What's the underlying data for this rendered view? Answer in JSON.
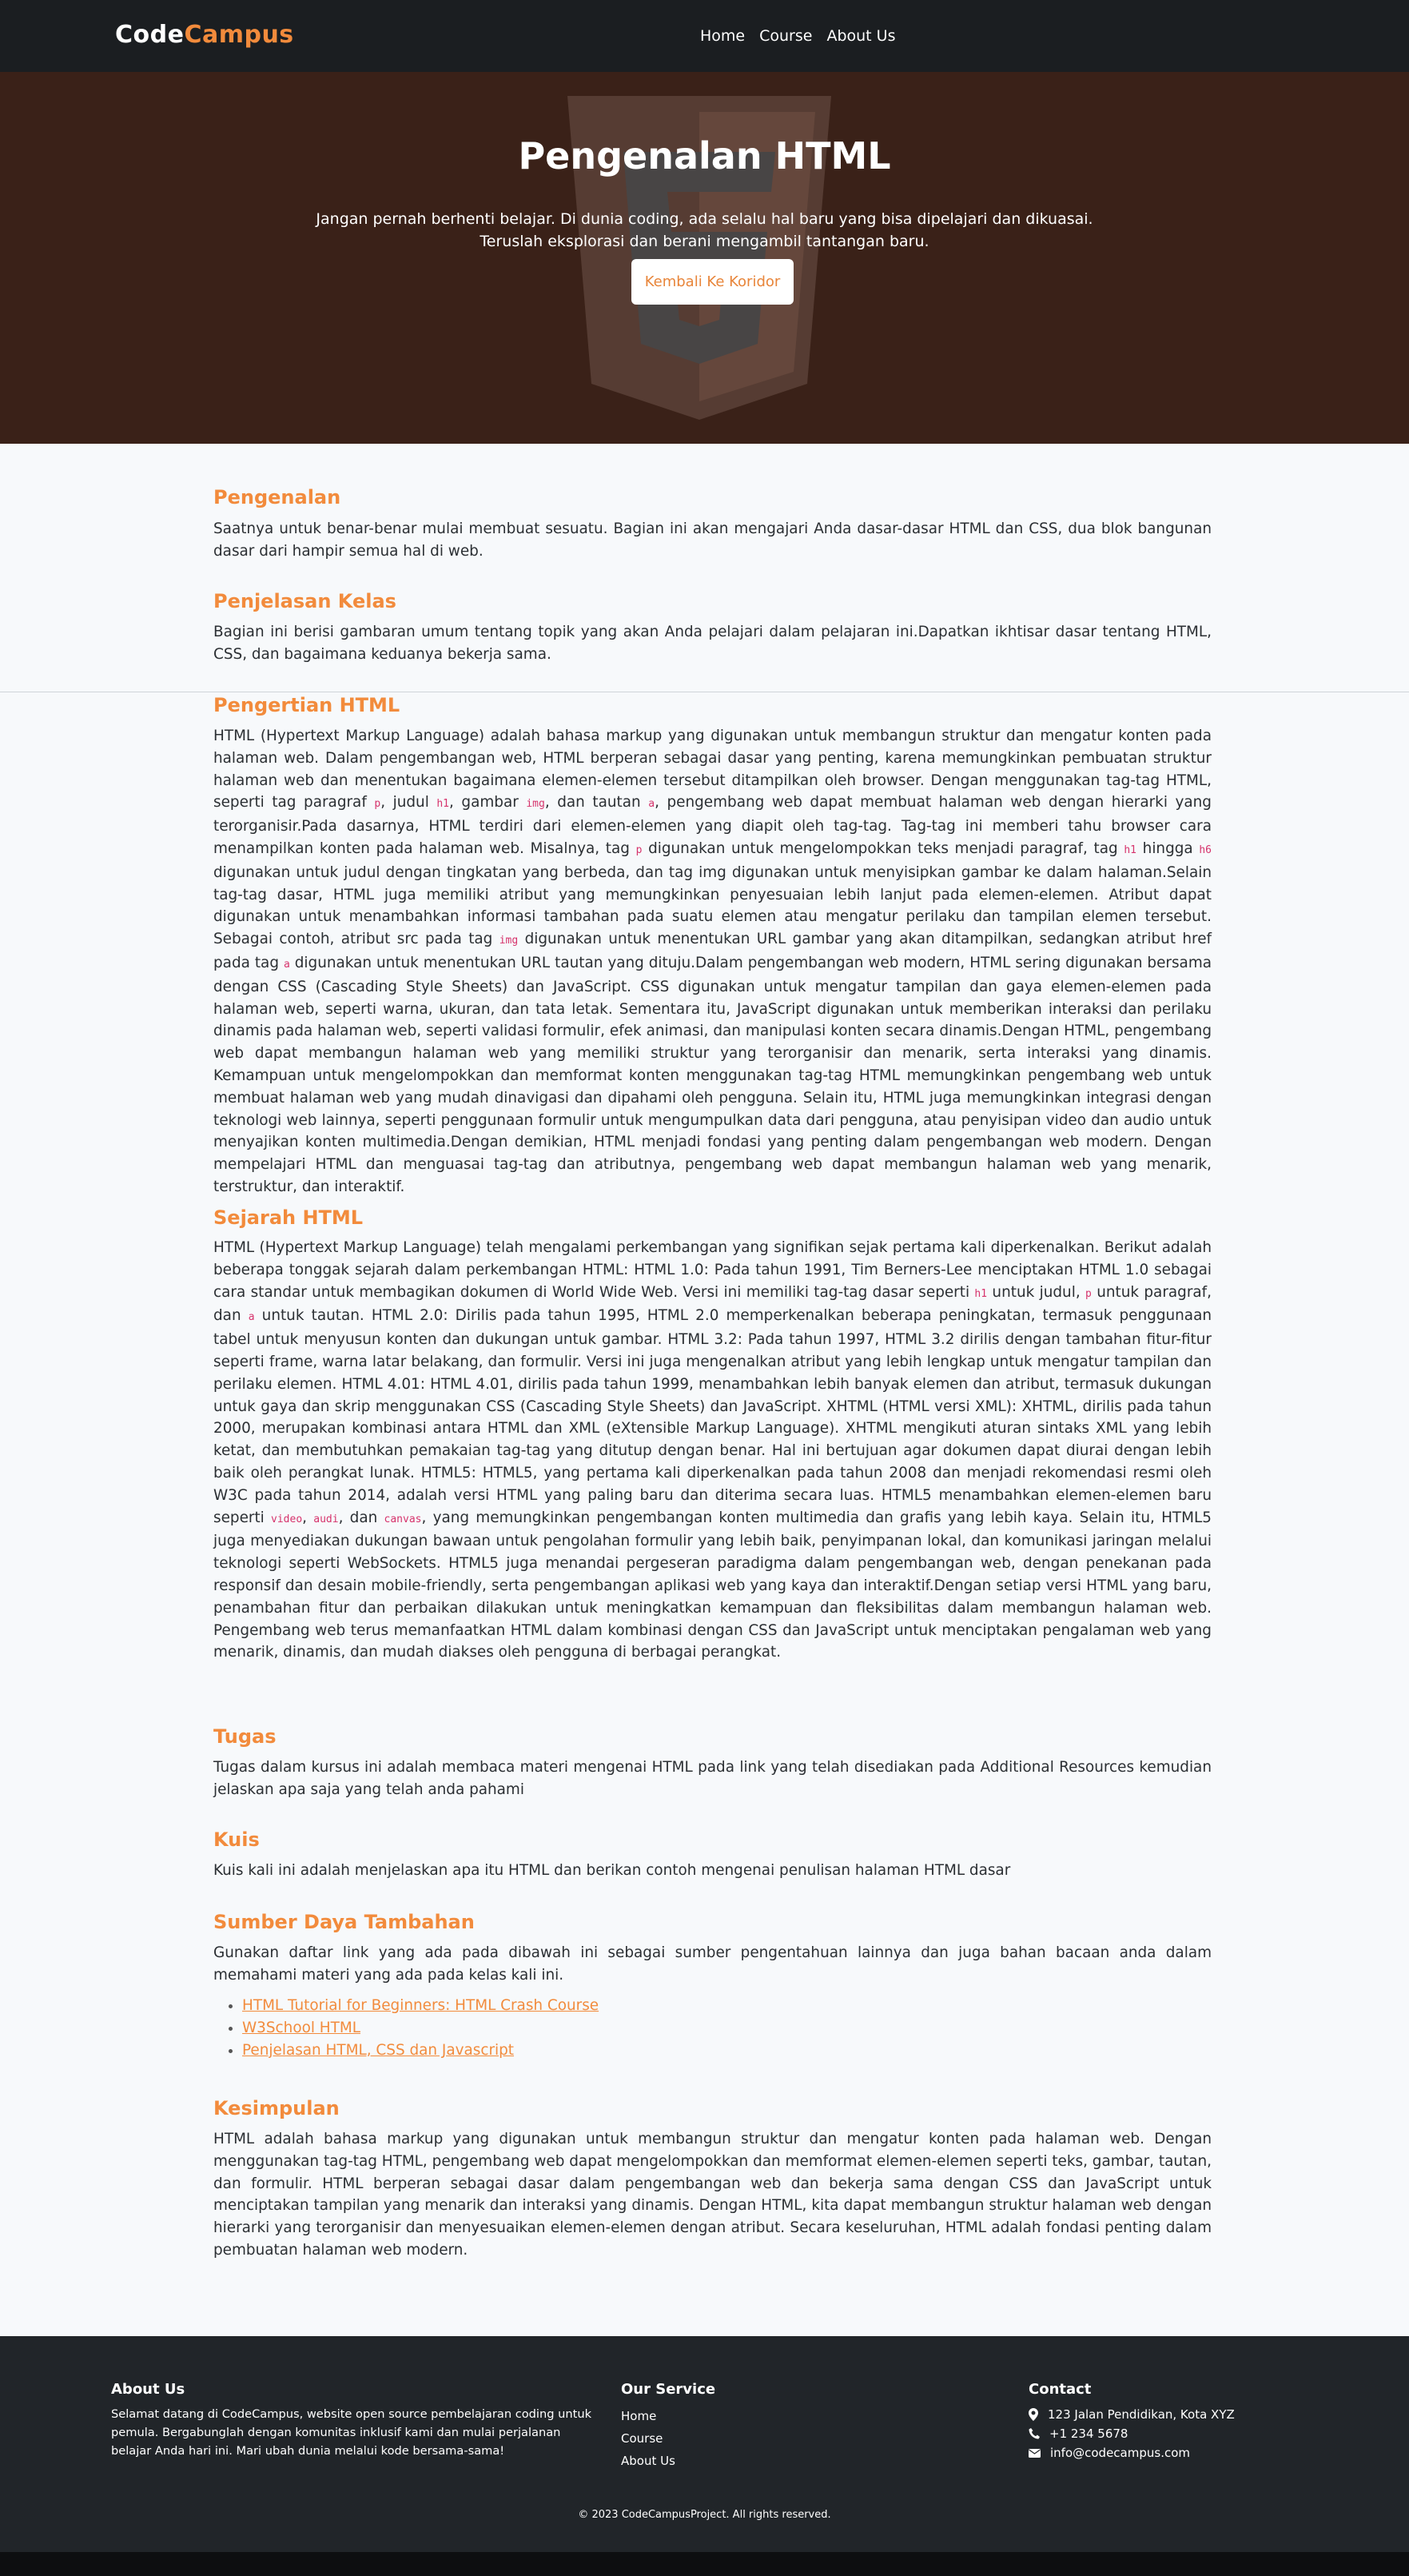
{
  "brand": {
    "name_part1": "Code",
    "name_part2": "Campus"
  },
  "nav": {
    "items": [
      "Home",
      "Course",
      "About Us"
    ]
  },
  "hero": {
    "title": "Pengenalan HTML",
    "subtitle_line1": "Jangan pernah berhenti belajar. Di dunia coding, ada selalu hal baru yang bisa dipelajari dan dikuasai.",
    "subtitle_line2": "Teruslah eksplorasi dan berani mengambil tantangan baru.",
    "button": "Kembali Ke Koridor",
    "background_icon": "html5-shield-icon"
  },
  "sections": {
    "pengenalan": {
      "title": "Pengenalan",
      "text": "Saatnya untuk benar-benar mulai membuat sesuatu. Bagian ini akan mengajari Anda dasar-dasar HTML dan CSS, dua blok bangunan dasar dari hampir semua hal di web."
    },
    "penjelasan": {
      "title": "Penjelasan Kelas",
      "text": "Bagian ini berisi gambaran umum tentang topik yang akan Anda pelajari dalam pelajaran ini.Dapatkan ikhtisar dasar tentang HTML, CSS, dan bagaimana keduanya bekerja sama."
    },
    "pengertian": {
      "title": "Pengertian HTML"
    },
    "sejarah": {
      "title": "Sejarah HTML"
    },
    "tugas": {
      "title": "Tugas",
      "text": "Tugas dalam kursus ini adalah membaca materi mengenai HTML pada link yang telah disediakan pada Additional Resources kemudian jelaskan apa saja yang telah anda pahami"
    },
    "kuis": {
      "title": "Kuis",
      "text": "Kuis kali ini adalah menjelaskan apa itu HTML dan berikan contoh mengenai penulisan halaman HTML dasar"
    },
    "sumber": {
      "title": "Sumber Daya Tambahan",
      "text": "Gunakan daftar link yang ada pada dibawah ini sebagai sumber pengentahuan lainnya dan juga bahan bacaan anda dalam memahami materi yang ada pada kelas kali ini.",
      "links": [
        "HTML Tutorial for Beginners: HTML Crash Course",
        "W3School HTML",
        "Penjelasan HTML, CSS dan Javascript"
      ]
    },
    "kesimpulan": {
      "title": "Kesimpulan",
      "text": "HTML adalah bahasa markup yang digunakan untuk membangun struktur dan mengatur konten pada halaman web. Dengan menggunakan tag-tag HTML, pengembang web dapat mengelompokkan dan memformat elemen-elemen seperti teks, gambar, tautan, dan formulir. HTML berperan sebagai dasar dalam pengembangan web dan bekerja sama dengan CSS dan JavaScript untuk menciptakan tampilan yang menarik dan interaksi yang dinamis. Dengan HTML, kita dapat membangun struktur halaman web dengan hierarki yang terorganisir dan menyesuaikan elemen-elemen dengan atribut. Secara keseluruhan, HTML adalah fondasi penting dalam pembuatan halaman web modern."
    }
  },
  "pengertian_text": {
    "s1": "HTML (Hypertext Markup Language) adalah bahasa markup yang digunakan untuk membangun struktur dan mengatur konten pada halaman web. Dalam pengembangan web, HTML berperan sebagai dasar yang penting, karena memungkinkan pembuatan struktur halaman web dan menentukan bagaimana elemen-elemen tersebut ditampilkan oleh browser. Dengan menggunakan tag-tag HTML, seperti tag paragraf ",
    "c1": "p",
    "s2": ", judul ",
    "c2": "h1",
    "s3": ", gambar ",
    "c3": "img",
    "s4": ", dan tautan ",
    "c4": "a",
    "s5": ", pengembang web dapat membuat halaman web dengan hierarki yang terorganisir.Pada dasarnya, HTML terdiri dari elemen-elemen yang diapit oleh tag-tag. Tag-tag ini memberi tahu browser cara menampilkan konten pada halaman web. Misalnya, tag ",
    "c5": "p",
    "s6": " digunakan untuk mengelompokkan teks menjadi paragraf, tag ",
    "c6": "h1",
    "s7": " hingga ",
    "c7": "h6",
    "s8": " digunakan untuk judul dengan tingkatan yang berbeda, dan tag img digunakan untuk menyisipkan gambar ke dalam halaman.Selain tag-tag dasar, HTML juga memiliki atribut yang memungkinkan penyesuaian lebih lanjut pada elemen-elemen. Atribut dapat digunakan untuk menambahkan informasi tambahan pada suatu elemen atau mengatur perilaku dan tampilan elemen tersebut. Sebagai contoh, atribut src pada tag ",
    "c8": "img",
    "s9": " digunakan untuk menentukan URL gambar yang akan ditampilkan, sedangkan atribut href pada tag ",
    "c9": "a",
    "s10": " digunakan untuk menentukan URL tautan yang dituju.Dalam pengembangan web modern, HTML sering digunakan bersama dengan CSS (Cascading Style Sheets) dan JavaScript. CSS digunakan untuk mengatur tampilan dan gaya elemen-elemen pada halaman web, seperti warna, ukuran, dan tata letak. Sementara itu, JavaScript digunakan untuk memberikan interaksi dan perilaku dinamis pada halaman web, seperti validasi formulir, efek animasi, dan manipulasi konten secara dinamis.Dengan HTML, pengembang web dapat membangun halaman web yang memiliki struktur yang terorganisir dan menarik, serta interaksi yang dinamis. Kemampuan untuk mengelompokkan dan memformat konten menggunakan tag-tag HTML memungkinkan pengembang web untuk membuat halaman web yang mudah dinavigasi dan dipahami oleh pengguna. Selain itu, HTML juga memungkinkan integrasi dengan teknologi web lainnya, seperti penggunaan formulir untuk mengumpulkan data dari pengguna, atau penyisipan video dan audio untuk menyajikan konten multimedia.Dengan demikian, HTML menjadi fondasi yang penting dalam pengembangan web modern. Dengan mempelajari HTML dan menguasai tag-tag dan atributnya, pengembang web dapat membangun halaman web yang menarik, terstruktur, dan interaktif."
  },
  "sejarah_text": {
    "s1": "HTML (Hypertext Markup Language) telah mengalami perkembangan yang signifikan sejak pertama kali diperkenalkan. Berikut adalah beberapa tonggak sejarah dalam perkembangan HTML: HTML 1.0: Pada tahun 1991, Tim Berners-Lee menciptakan HTML 1.0 sebagai cara standar untuk membagikan dokumen di World Wide Web. Versi ini memiliki tag-tag dasar seperti ",
    "c1": "h1",
    "s2": " untuk judul, ",
    "c2": "p",
    "s3": " untuk paragraf, dan ",
    "c3": "a",
    "s4": " untuk tautan. HTML 2.0: Dirilis pada tahun 1995, HTML 2.0 memperkenalkan beberapa peningkatan, termasuk penggunaan tabel untuk menyusun konten dan dukungan untuk gambar. HTML 3.2: Pada tahun 1997, HTML 3.2 dirilis dengan tambahan fitur-fitur seperti frame, warna latar belakang, dan formulir. Versi ini juga mengenalkan atribut yang lebih lengkap untuk mengatur tampilan dan perilaku elemen. HTML 4.01: HTML 4.01, dirilis pada tahun 1999, menambahkan lebih banyak elemen dan atribut, termasuk dukungan untuk gaya dan skrip menggunakan CSS (Cascading Style Sheets) dan JavaScript. XHTML (HTML versi XML): XHTML, dirilis pada tahun 2000, merupakan kombinasi antara HTML dan XML (eXtensible Markup Language). XHTML mengikuti aturan sintaks XML yang lebih ketat, dan membutuhkan pemakaian tag-tag yang ditutup dengan benar. Hal ini bertujuan agar dokumen dapat diurai dengan lebih baik oleh perangkat lunak. HTML5: HTML5, yang pertama kali diperkenalkan pada tahun 2008 dan menjadi rekomendasi resmi oleh W3C pada tahun 2014, adalah versi HTML yang paling baru dan diterima secara luas. HTML5 menambahkan elemen-elemen baru seperti ",
    "c4": "video",
    "s5": ", ",
    "c5": "audi",
    "s6": ", dan ",
    "c6": "canvas",
    "s7": ", yang memungkinkan pengembangan konten multimedia dan grafis yang lebih kaya. Selain itu, HTML5 juga menyediakan dukungan bawaan untuk pengolahan formulir yang lebih baik, penyimpanan lokal, dan komunikasi jaringan melalui teknologi seperti WebSockets. HTML5 juga menandai pergeseran paradigma dalam pengembangan web, dengan penekanan pada responsif dan desain mobile-friendly, serta pengembangan aplikasi web yang kaya dan interaktif.Dengan setiap versi HTML yang baru, penambahan fitur dan perbaikan dilakukan untuk meningkatkan kemampuan dan fleksibilitas dalam membangun halaman web. Pengembang web terus memanfaatkan HTML dalam kombinasi dengan CSS dan JavaScript untuk menciptakan pengalaman web yang menarik, dinamis, dan mudah diakses oleh pengguna di berbagai perangkat."
  },
  "footer": {
    "about_title": "About Us",
    "about_text": "Selamat datang di CodeCampus, website open source pembelajaran coding untuk pemula. Bergabunglah dengan komunitas inklusif kami dan mulai perjalanan belajar Anda hari ini. Mari ubah dunia melalui kode bersama-sama!",
    "service_title": "Our Service",
    "service_links": [
      "Home",
      "Course",
      "About Us"
    ],
    "contact_title": "Contact",
    "address": "123 Jalan Pendidikan, Kota XYZ",
    "phone": "+1 234 5678",
    "email": "info@codecampus.com",
    "copyright": "© 2023 CodeCampusProject. All rights reserved."
  },
  "colors": {
    "accent": "#f28b3c",
    "navbar": "#1b1e21",
    "hero": "#3a2118",
    "footer": "#212529",
    "code": "#d6336c"
  }
}
